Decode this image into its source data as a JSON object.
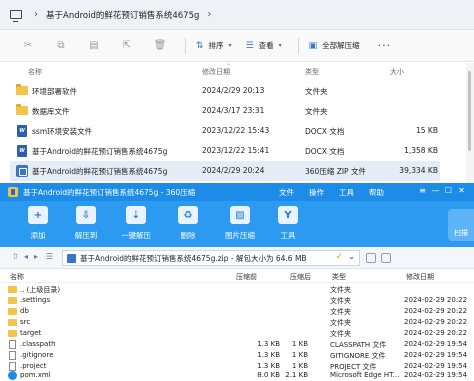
{
  "explorer": {
    "breadcrumb": "基于Android的鲜花预订销售系统4675g",
    "toolbar": {
      "sort_label": "排序",
      "view_label": "查看",
      "extract_all_label": "全部解压缩",
      "more_label": "···"
    },
    "columns": {
      "name": "名称",
      "modified": "修改日期",
      "type": "类型",
      "size": "大小"
    },
    "rows": [
      {
        "name": "环境部署软件",
        "modified": "2024/2/29 20:13",
        "type": "文件夹",
        "size": "",
        "icon": "folder-icon"
      },
      {
        "name": "数据库文件",
        "modified": "2024/3/17 23:31",
        "type": "文件夹",
        "size": "",
        "icon": "folder-icon"
      },
      {
        "name": "ssm环境安装文件",
        "modified": "2023/12/22 15:43",
        "type": "DOCX 文档",
        "size": "15 KB",
        "icon": "word-doc-icon"
      },
      {
        "name": "基于Android的鲜花预订销售系统4675g",
        "modified": "2023/12/22 15:41",
        "type": "DOCX 文档",
        "size": "1,358 KB",
        "icon": "word-doc-icon"
      },
      {
        "name": "基于Android的鲜花预订销售系统4675g",
        "modified": "2024/2/29 20:24",
        "type": "360压缩 ZIP 文件",
        "size": "39,334 KB",
        "icon": "zip-file-icon"
      }
    ]
  },
  "zip": {
    "title": "基于Android的鲜花预订销售系统4675g - 360压缩",
    "menu": [
      "文件",
      "操作",
      "工具",
      "帮助"
    ],
    "window_controls": [
      "≡",
      "—",
      "☐",
      "✕"
    ],
    "tools": [
      {
        "label": "添加",
        "icon": "add-icon"
      },
      {
        "label": "解压到",
        "icon": "extract-to-icon"
      },
      {
        "label": "一键解压",
        "icon": "one-click-extract-icon"
      },
      {
        "label": "删除",
        "icon": "delete-icon"
      },
      {
        "label": "图片压缩",
        "icon": "image-compress-icon"
      },
      {
        "label": "工具",
        "icon": "tools-icon"
      }
    ],
    "scan_label": "扫描",
    "path": "基于Android的鲜花预订销售系统4675g.zip - 解包大小为 64.6 MB",
    "columns": {
      "name": "名称",
      "compressed": "压缩前",
      "packed": "压缩后",
      "type": "类型",
      "modified": "修改日期"
    },
    "rows": [
      {
        "name": ".. (上级目录)",
        "compressed": "",
        "packed": "",
        "type": "文件夹",
        "modified": ""
      },
      {
        "name": ".settings",
        "compressed": "",
        "packed": "",
        "type": "文件夹",
        "modified": "2024-02-29 20:22"
      },
      {
        "name": "db",
        "compressed": "",
        "packed": "",
        "type": "文件夹",
        "modified": "2024-02-29 20:22"
      },
      {
        "name": "src",
        "compressed": "",
        "packed": "",
        "type": "文件夹",
        "modified": "2024-02-29 20:22"
      },
      {
        "name": "target",
        "compressed": "",
        "packed": "",
        "type": "文件夹",
        "modified": "2024-02-29 20:22"
      },
      {
        "name": ".classpath",
        "compressed": "1.3 KB",
        "packed": "1 KB",
        "type": "CLASSPATH 文件",
        "modified": "2024-02-29 19:54"
      },
      {
        "name": ".gitignore",
        "compressed": "1.3 KB",
        "packed": "1 KB",
        "type": "GITIGNORE 文件",
        "modified": "2024-02-29 19:54"
      },
      {
        "name": ".project",
        "compressed": "1.3 KB",
        "packed": "1 KB",
        "type": "PROJECT 文件",
        "modified": "2024-02-29 19:54"
      },
      {
        "name": "pom.xml",
        "compressed": "8.0 KB",
        "packed": "2.1 KB",
        "type": "Microsoft Edge HT...",
        "modified": "2024-02-29 19:54"
      }
    ]
  },
  "colors": {
    "zip_titlebar": "#1d8ce8",
    "zip_toolbar": "#2b9af0",
    "selected_row": "#e5ecf5",
    "folder": "#f3c44a"
  }
}
